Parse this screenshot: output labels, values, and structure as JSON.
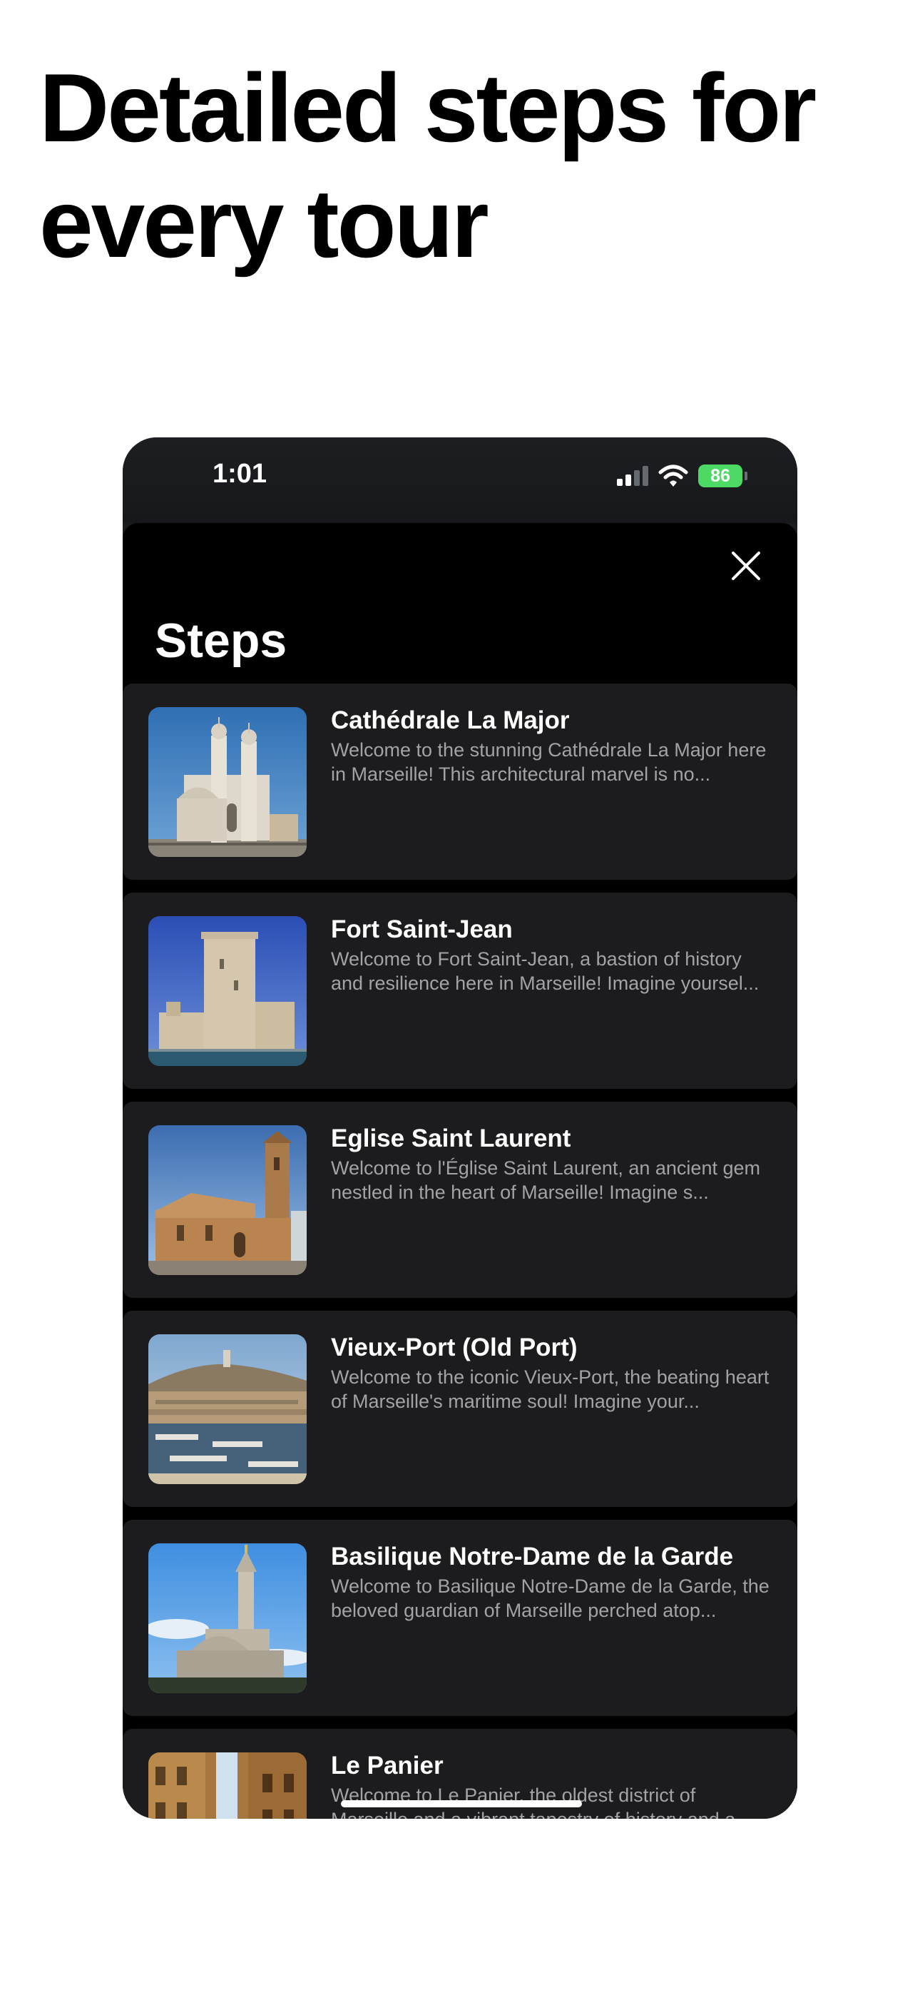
{
  "headline": "Detailed steps for every tour",
  "status_bar": {
    "time": "1:01",
    "battery_level": "86",
    "icons": [
      "cellular-signal-icon",
      "wifi-icon",
      "battery-charging-icon"
    ],
    "signal_bars_active": 2,
    "signal_bars_total": 4
  },
  "sheet": {
    "title": "Steps",
    "close_icon": "close-icon"
  },
  "steps": [
    {
      "title": "Cathédrale La Major",
      "description": "Welcome to the stunning Cathédrale La Major here in Marseille! This architectural marvel is no...",
      "image": "cathedral-photo"
    },
    {
      "title": "Fort Saint-Jean",
      "description": "Welcome to Fort Saint-Jean, a bastion of history and resilience here in Marseille! Imagine yoursel...",
      "image": "fort-photo"
    },
    {
      "title": "Eglise Saint Laurent",
      "description": "Welcome to l'Église Saint Laurent, an ancient gem nestled in the heart of Marseille! Imagine s...",
      "image": "church-photo"
    },
    {
      "title": "Vieux-Port (Old Port)",
      "description": "Welcome to the iconic Vieux-Port, the beating heart of Marseille's maritime soul! Imagine your...",
      "image": "harbor-photo"
    },
    {
      "title": "Basilique Notre-Dame de la Garde",
      "description": "Welcome to Basilique Notre-Dame de la Garde, the beloved guardian of Marseille perched atop...",
      "image": "basilica-photo"
    },
    {
      "title": "Le Panier",
      "description": "Welcome to Le Panier, the oldest district of Marseille and a vibrant tapestry of history and a...",
      "image": "street-photo"
    }
  ],
  "colors": {
    "page_background": "#ffffff",
    "headline": "#000000",
    "sheet_background": "#000000",
    "card_background": "#1c1c1e",
    "title_text": "#ffffff",
    "description_text": "#a2a2a7",
    "battery": "#4cd964"
  }
}
